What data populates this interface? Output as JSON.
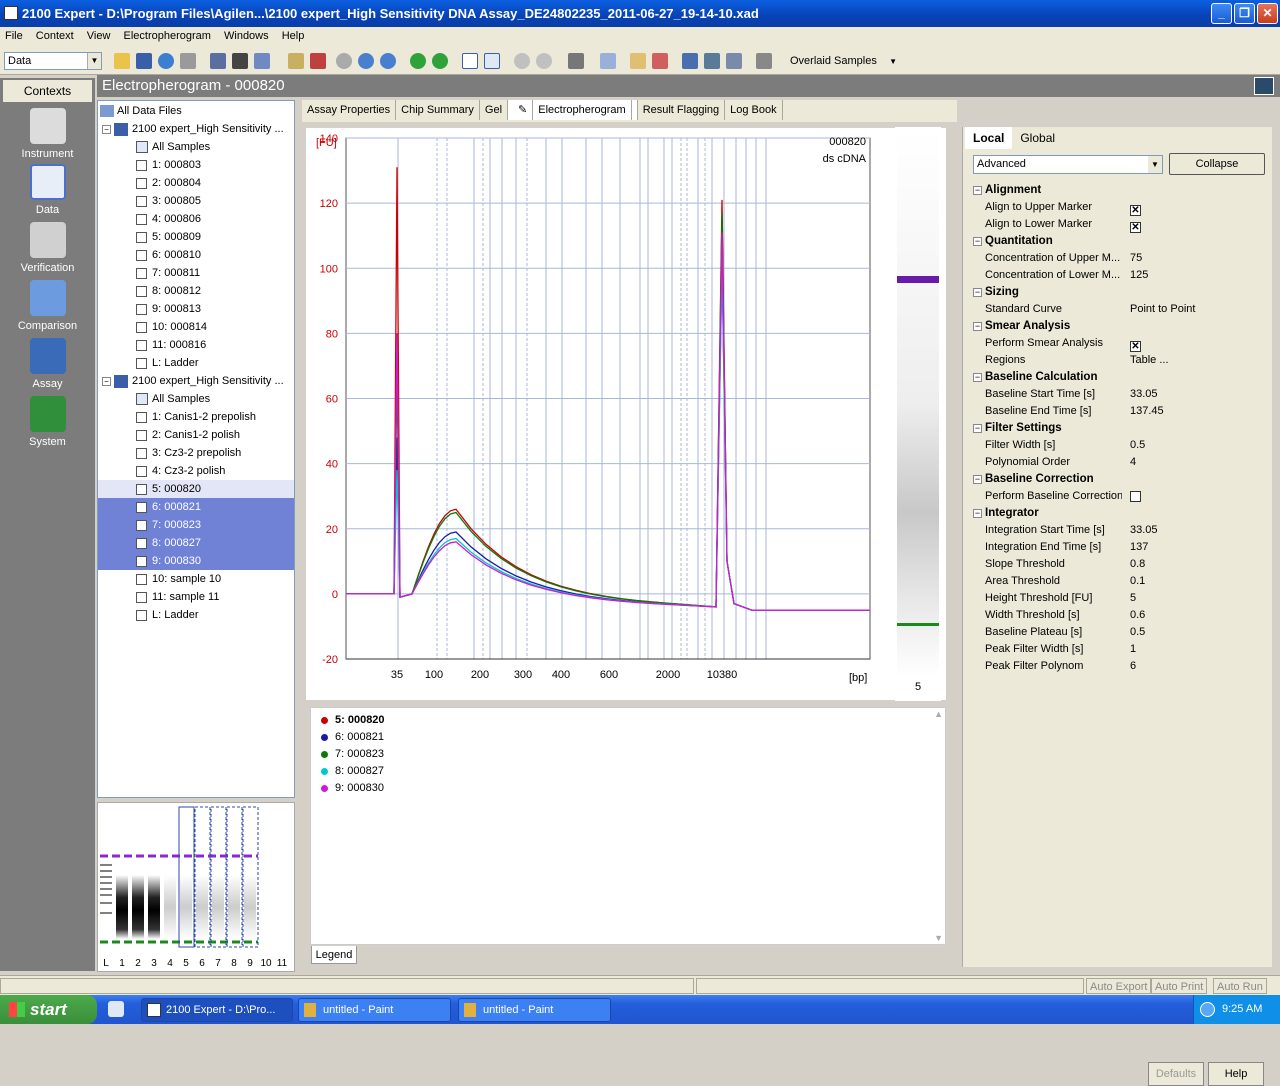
{
  "window": {
    "title": "2100 Expert - D:\\Program Files\\Agilen...\\2100 expert_High Sensitivity DNA Assay_DE24802235_2011-06-27_19-14-10.xad"
  },
  "menu": [
    "File",
    "Context",
    "View",
    "Electropherogram",
    "Windows",
    "Help"
  ],
  "toolbar": {
    "context_value": "Data",
    "overlaid_label": "Overlaid Samples"
  },
  "contexts": {
    "header": "Contexts",
    "items": [
      "Instrument",
      "Data",
      "Verification",
      "Comparison",
      "Assay",
      "System"
    ]
  },
  "main_title": "Electropherogram - 000820",
  "tree": {
    "root": "All Data Files",
    "file1": "2100 expert_High Sensitivity ...",
    "file1_items": [
      "All Samples",
      "1: 000803",
      "2: 000804",
      "3: 000805",
      "4: 000806",
      "5: 000809",
      "6: 000810",
      "7: 000811",
      "8: 000812",
      "9: 000813",
      "10: 000814",
      "11: 000816",
      "L: Ladder"
    ],
    "file2": "2100 expert_High Sensitivity ...",
    "file2_items": [
      "All Samples",
      "1: Canis1-2 prepolish",
      "2: Canis1-2 polish",
      "3: Cz3-2 prepolish",
      "4: Cz3-2 polish",
      "5: 000820",
      "6: 000821",
      "7: 000823",
      "8: 000827",
      "9: 000830",
      "10: sample 10",
      "11: sample 11",
      "L: Ladder"
    ]
  },
  "gel_thumb_labels": [
    "L",
    "1",
    "2",
    "3",
    "4",
    "5",
    "6",
    "7",
    "8",
    "9",
    "10",
    "11"
  ],
  "tabs": [
    "Assay Properties",
    "Chip Summary",
    "Gel",
    "Electropherogram",
    "Result Flagging",
    "Log Book"
  ],
  "chart_data": {
    "type": "line",
    "title": "000820",
    "subtitle": "ds cDNA",
    "ylabel": "[FU]",
    "xlabel": "[bp]",
    "ylim": [
      -20,
      140
    ],
    "yticks": [
      -20,
      0,
      20,
      40,
      60,
      80,
      100,
      120,
      140
    ],
    "xtick_labels": [
      "35",
      "100",
      "200",
      "300",
      "400",
      "600",
      "2000",
      "10380"
    ],
    "x_axis": "time-based; labelled in bp",
    "series": [
      {
        "name": "5: 000820",
        "color": "#cc0000",
        "marker_peak_35": 131,
        "smear_peak": 26,
        "marker_peak_10380": 121
      },
      {
        "name": "6: 000821",
        "color": "#1a1aa8",
        "marker_peak_35": 48,
        "smear_peak": 19,
        "marker_peak_10380": 104
      },
      {
        "name": "7: 000823",
        "color": "#0a7a0a",
        "marker_peak_35": 68,
        "smear_peak": 25,
        "marker_peak_10380": 117
      },
      {
        "name": "8: 000827",
        "color": "#00c8d2",
        "marker_peak_35": 38,
        "smear_peak": 17,
        "marker_peak_10380": 100
      },
      {
        "name": "9: 000830",
        "color": "#d01ad0",
        "marker_peak_35": 80,
        "smear_peak": 16,
        "marker_peak_10380": 111
      }
    ]
  },
  "gel_lane_label": "5",
  "legend": {
    "tab": "Legend",
    "items": [
      "5: 000820",
      "6: 000821",
      "7: 000823",
      "8: 000827",
      "9: 000830"
    ]
  },
  "props": {
    "tabs": [
      "Local",
      "Global"
    ],
    "mode": "Advanced",
    "collapse": "Collapse",
    "rows": [
      {
        "k": "Alignment",
        "sec": true
      },
      {
        "k": "Align to Upper Marker",
        "check": true
      },
      {
        "k": "Align to Lower Marker",
        "check": true
      },
      {
        "k": "Quantitation",
        "sec": true
      },
      {
        "k": "Concentration of Upper M...",
        "v": "75"
      },
      {
        "k": "Concentration of Lower M...",
        "v": "125"
      },
      {
        "k": "Sizing",
        "sec": true
      },
      {
        "k": "Standard Curve",
        "v": "Point to Point"
      },
      {
        "k": "Smear Analysis",
        "sec": true
      },
      {
        "k": "Perform Smear Analysis",
        "check": true
      },
      {
        "k": "Regions",
        "v": "Table ..."
      },
      {
        "k": "Baseline Calculation",
        "sec": true
      },
      {
        "k": "Baseline Start Time [s]",
        "v": "33.05"
      },
      {
        "k": "Baseline End Time [s]",
        "v": "137.45"
      },
      {
        "k": "Filter Settings",
        "sec": true
      },
      {
        "k": "Filter Width [s]",
        "v": "0.5"
      },
      {
        "k": "Polynomial Order",
        "v": "4"
      },
      {
        "k": "Baseline Correction",
        "sec": true
      },
      {
        "k": "Perform Baseline Correction",
        "check": false
      },
      {
        "k": "Integrator",
        "sec": true
      },
      {
        "k": "Integration Start Time [s]",
        "v": "33.05"
      },
      {
        "k": "Integration End Time [s]",
        "v": "137"
      },
      {
        "k": "Slope Threshold",
        "v": "0.8"
      },
      {
        "k": "Area Threshold",
        "v": "0.1"
      },
      {
        "k": "Height Threshold [FU]",
        "v": "5"
      },
      {
        "k": "Width Threshold [s]",
        "v": "0.6"
      },
      {
        "k": "Baseline Plateau [s]",
        "v": "0.5"
      },
      {
        "k": "Peak Filter Width [s]",
        "v": "1"
      },
      {
        "k": "Peak Filter Polynom",
        "v": "6"
      }
    ],
    "defaults": "Defaults",
    "help": "Help"
  },
  "status": [
    "Auto Export",
    "Auto Print",
    "Auto Run"
  ],
  "taskbar": {
    "start": "start",
    "tasks": [
      "2100 Expert - D:\\Pro...",
      "untitled - Paint",
      "untitled - Paint"
    ],
    "clock": "9:25 AM"
  }
}
